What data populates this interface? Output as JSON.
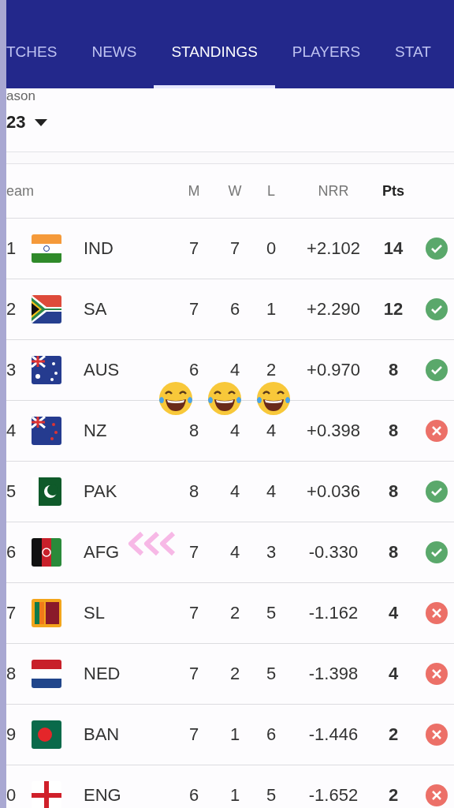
{
  "tabs": [
    {
      "label": "TCHES",
      "selected": false
    },
    {
      "label": "NEWS",
      "selected": false
    },
    {
      "label": "STANDINGS",
      "selected": true
    },
    {
      "label": "PLAYERS",
      "selected": false
    },
    {
      "label": "STAT",
      "selected": false
    }
  ],
  "season": {
    "label": "ason",
    "value": "23"
  },
  "table": {
    "columns": [
      "eam",
      "M",
      "W",
      "L",
      "NRR",
      "Pts"
    ],
    "rows": [
      {
        "rank": "1",
        "team": "IND",
        "m": "7",
        "w": "7",
        "l": "0",
        "nrr": "+2.102",
        "pts": "14",
        "qualified": true
      },
      {
        "rank": "2",
        "team": "SA",
        "m": "7",
        "w": "6",
        "l": "1",
        "nrr": "+2.290",
        "pts": "12",
        "qualified": true
      },
      {
        "rank": "3",
        "team": "AUS",
        "m": "6",
        "w": "4",
        "l": "2",
        "nrr": "+0.970",
        "pts": "8",
        "qualified": true
      },
      {
        "rank": "4",
        "team": "NZ",
        "m": "8",
        "w": "4",
        "l": "4",
        "nrr": "+0.398",
        "pts": "8",
        "qualified": false
      },
      {
        "rank": "5",
        "team": "PAK",
        "m": "8",
        "w": "4",
        "l": "4",
        "nrr": "+0.036",
        "pts": "8",
        "qualified": true
      },
      {
        "rank": "6",
        "team": "AFG",
        "m": "7",
        "w": "4",
        "l": "3",
        "nrr": "-0.330",
        "pts": "8",
        "qualified": true
      },
      {
        "rank": "7",
        "team": "SL",
        "m": "7",
        "w": "2",
        "l": "5",
        "nrr": "-1.162",
        "pts": "4",
        "qualified": false
      },
      {
        "rank": "8",
        "team": "NED",
        "m": "7",
        "w": "2",
        "l": "5",
        "nrr": "-1.398",
        "pts": "4",
        "qualified": false
      },
      {
        "rank": "9",
        "team": "BAN",
        "m": "7",
        "w": "1",
        "l": "6",
        "nrr": "-1.446",
        "pts": "2",
        "qualified": false
      },
      {
        "rank": "0",
        "team": "ENG",
        "m": "6",
        "w": "1",
        "l": "5",
        "nrr": "-1.652",
        "pts": "2",
        "qualified": false
      }
    ]
  }
}
